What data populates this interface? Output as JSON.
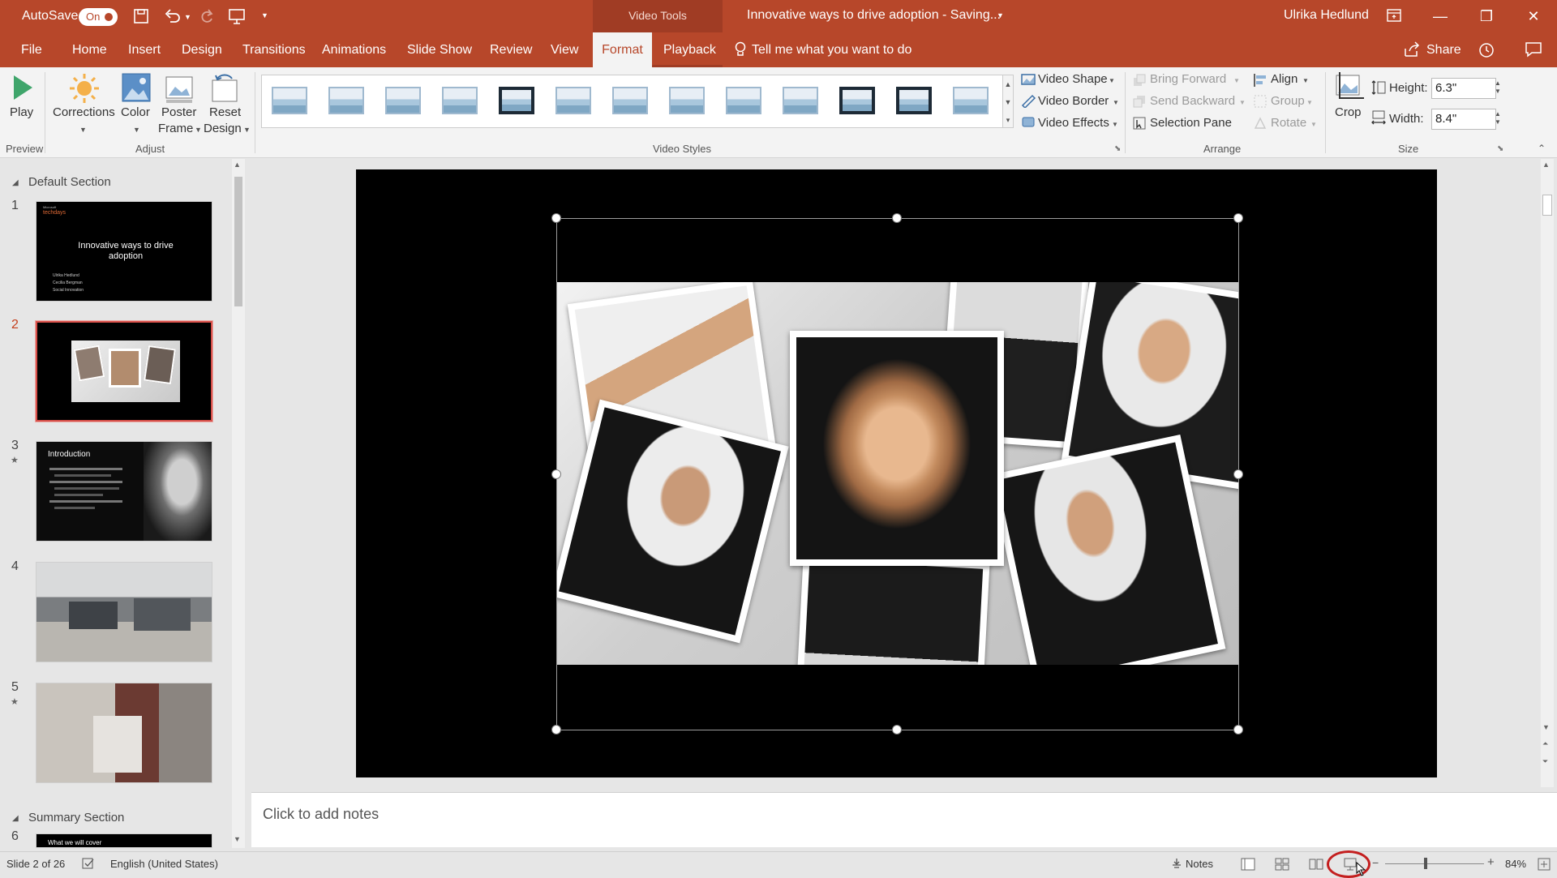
{
  "titlebar": {
    "autosave_label": "AutoSave",
    "autosave_state": "On",
    "context_tools": "Video Tools",
    "doc_title": "Innovative ways to drive adoption  -  Saving...",
    "user_name": "Ulrika Hedlund"
  },
  "tabs": [
    {
      "label": "File"
    },
    {
      "label": "Home"
    },
    {
      "label": "Insert"
    },
    {
      "label": "Design"
    },
    {
      "label": "Transitions"
    },
    {
      "label": "Animations"
    },
    {
      "label": "Slide Show"
    },
    {
      "label": "Review"
    },
    {
      "label": "View"
    },
    {
      "label": "Format"
    },
    {
      "label": "Playback"
    }
  ],
  "tell_me": "Tell me what you want to do",
  "share_label": "Share",
  "ribbon": {
    "play": "Play",
    "corrections": "Corrections",
    "color": "Color",
    "poster_frame_1": "Poster",
    "poster_frame_2": "Frame",
    "reset_design_1": "Reset",
    "reset_design_2": "Design",
    "group_preview": "Preview",
    "group_adjust": "Adjust",
    "group_video_styles": "Video Styles",
    "video_shape": "Video Shape",
    "video_border": "Video Border",
    "video_effects": "Video Effects",
    "bring_forward": "Bring Forward",
    "send_backward": "Send Backward",
    "selection_pane": "Selection Pane",
    "align": "Align",
    "group": "Group",
    "rotate": "Rotate",
    "group_arrange": "Arrange",
    "crop": "Crop",
    "height_label": "Height:",
    "height_value": "6.3\"",
    "width_label": "Width:",
    "width_value": "8.4\"",
    "group_size": "Size"
  },
  "sections": {
    "default": "Default Section",
    "summary": "Summary Section"
  },
  "slides": [
    {
      "num": "1",
      "title": "Innovative ways to drive adoption",
      "brand_small": "Microsoft",
      "brand": "techdays",
      "names": [
        "Ulrika Hedlund",
        "Cecilia Bergman",
        "Social Innovation"
      ]
    },
    {
      "num": "2"
    },
    {
      "num": "3",
      "title": "Introduction",
      "star": "★"
    },
    {
      "num": "4"
    },
    {
      "num": "5",
      "star": "★"
    },
    {
      "num": "6",
      "title": "What we will cover"
    }
  ],
  "notes_placeholder": "Click to add notes",
  "status": {
    "slide_info": "Slide 2 of 26",
    "language": "English (United States)",
    "notes": "Notes",
    "zoom": "84%"
  }
}
